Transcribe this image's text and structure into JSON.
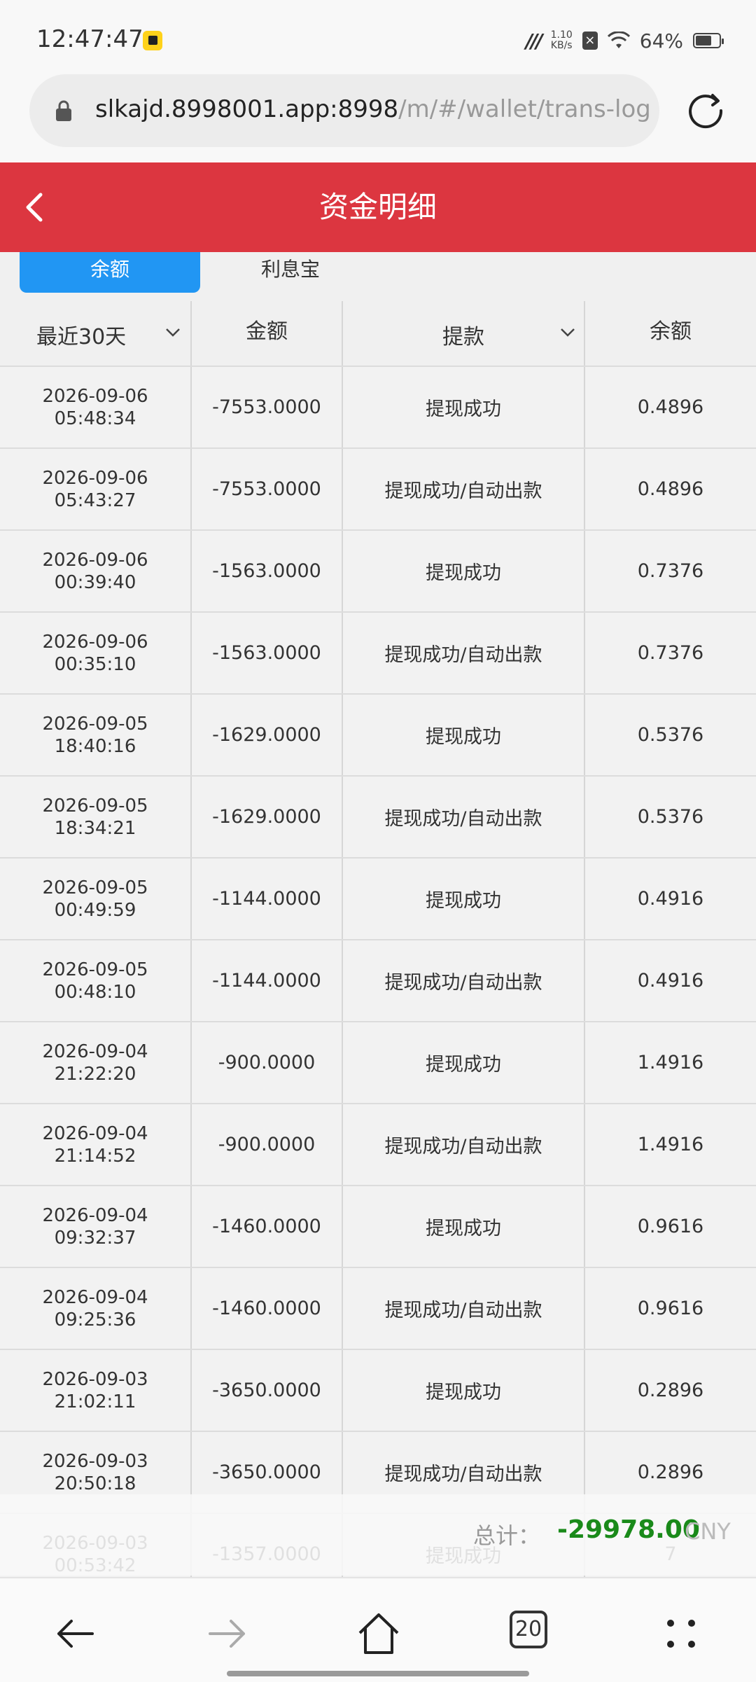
{
  "status_bar": {
    "time": "12:47:47",
    "net_speed_value": "1.10",
    "net_speed_unit": "KB/s",
    "battery": "64%"
  },
  "browser": {
    "url_host": "slkajd.8998001.app:8998",
    "url_path": "/m/#/wallet/trans-log",
    "tab_count": "20"
  },
  "header": {
    "title": "资金明细"
  },
  "tabs": [
    {
      "label": "余额",
      "active": true
    },
    {
      "label": "利息宝",
      "active": false
    }
  ],
  "table": {
    "columns": [
      "最近30天",
      "金额",
      "提款",
      "余额"
    ],
    "rows": [
      {
        "date": "2026-09-06",
        "time": "05:48:34",
        "amount": "-7553.0000",
        "type": "提现成功",
        "balance": "0.4896"
      },
      {
        "date": "2026-09-06",
        "time": "05:43:27",
        "amount": "-7553.0000",
        "type": "提现成功/自动出款",
        "balance": "0.4896"
      },
      {
        "date": "2026-09-06",
        "time": "00:39:40",
        "amount": "-1563.0000",
        "type": "提现成功",
        "balance": "0.7376"
      },
      {
        "date": "2026-09-06",
        "time": "00:35:10",
        "amount": "-1563.0000",
        "type": "提现成功/自动出款",
        "balance": "0.7376"
      },
      {
        "date": "2026-09-05",
        "time": "18:40:16",
        "amount": "-1629.0000",
        "type": "提现成功",
        "balance": "0.5376"
      },
      {
        "date": "2026-09-05",
        "time": "18:34:21",
        "amount": "-1629.0000",
        "type": "提现成功/自动出款",
        "balance": "0.5376"
      },
      {
        "date": "2026-09-05",
        "time": "00:49:59",
        "amount": "-1144.0000",
        "type": "提现成功",
        "balance": "0.4916"
      },
      {
        "date": "2026-09-05",
        "time": "00:48:10",
        "amount": "-1144.0000",
        "type": "提现成功/自动出款",
        "balance": "0.4916"
      },
      {
        "date": "2026-09-04",
        "time": "21:22:20",
        "amount": "-900.0000",
        "type": "提现成功",
        "balance": "1.4916"
      },
      {
        "date": "2026-09-04",
        "time": "21:14:52",
        "amount": "-900.0000",
        "type": "提现成功/自动出款",
        "balance": "1.4916"
      },
      {
        "date": "2026-09-04",
        "time": "09:32:37",
        "amount": "-1460.0000",
        "type": "提现成功",
        "balance": "0.9616"
      },
      {
        "date": "2026-09-04",
        "time": "09:25:36",
        "amount": "-1460.0000",
        "type": "提现成功/自动出款",
        "balance": "0.9616"
      },
      {
        "date": "2026-09-03 21:02:11",
        "time": "",
        "amount": "-3650.0000",
        "type": "提现成功",
        "balance": "0.2896"
      },
      {
        "date": "2026-09-03",
        "time": "20:50:18",
        "amount": "-3650.0000",
        "type": "提现成功/自动出款",
        "balance": "0.2896"
      },
      {
        "date": "2026-09-03",
        "time": "00:53:42",
        "amount": "-1357.0000",
        "type": "提现成功",
        "balance": "7"
      }
    ]
  },
  "total": {
    "label": "总计：",
    "value": "-29978.00",
    "unit": "CNY"
  },
  "colors": {
    "header_red": "#dc3640",
    "tab_blue": "#2196f3",
    "total_green": "#1a8a1a"
  },
  "icons": [
    "lock-icon",
    "reload-icon",
    "back-icon",
    "chevron-down-icon",
    "nav-back-icon",
    "nav-forward-icon",
    "home-icon",
    "menu-dots-icon"
  ]
}
